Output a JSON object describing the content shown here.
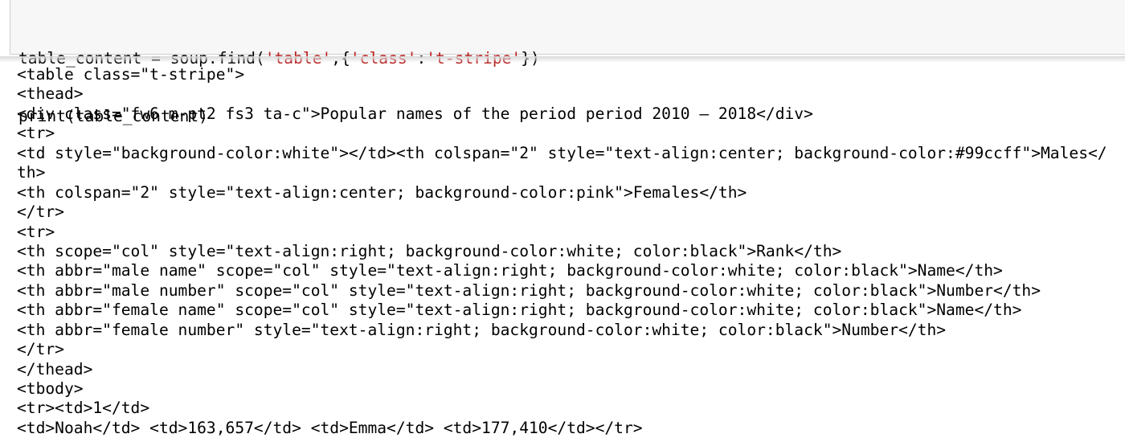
{
  "input_cell": {
    "line1": {
      "before": "table_content = soup.find(",
      "str1": "'table'",
      "mid1": ",{",
      "str2": "'class'",
      "mid2": ":",
      "str3": "'t-stripe'",
      "after": "})"
    },
    "line2": "print(table_content)"
  },
  "output_lines": [
    "<table class=\"t-stripe\">",
    "<thead>",
    "<div class=\"fw6 m-pt2 fs3 ta-c\">Popular names of the period period 2010 – 2018</div>",
    "<tr>",
    "<td style=\"background-color:white\"></td><th colspan=\"2\" style=\"text-align:center; background-color:#99ccff\">Males</",
    "th>",
    "<th colspan=\"2\" style=\"text-align:center; background-color:pink\">Females</th>",
    "</tr>",
    "<tr>",
    "<th scope=\"col\" style=\"text-align:right; background-color:white; color:black\">Rank</th>",
    "<th abbr=\"male name\" scope=\"col\" style=\"text-align:right; background-color:white; color:black\">Name</th>",
    "<th abbr=\"male number\" scope=\"col\" style=\"text-align:right; background-color:white; color:black\">Number</th>",
    "<th abbr=\"female name\" scope=\"col\" style=\"text-align:right; background-color:white; color:black\">Name</th>",
    "<th abbr=\"female number\" style=\"text-align:right; background-color:white; color:black\">Number</th>",
    "</tr>",
    "</thead>",
    "<tbody>",
    "<tr><td>1</td>",
    "<td>Noah</td> <td>163,657</td> <td>Emma</td> <td>177,410</td></tr>"
  ]
}
